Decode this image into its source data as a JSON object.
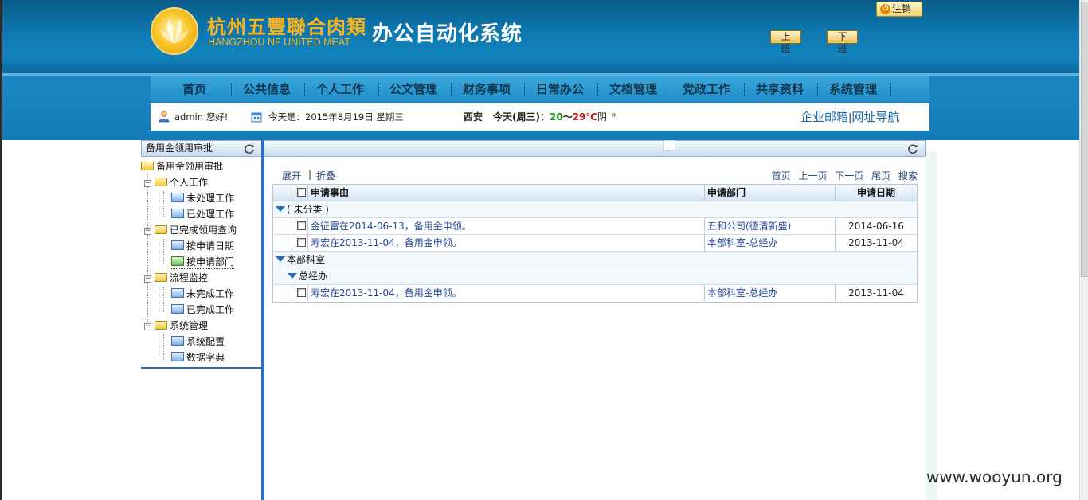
{
  "header": {
    "company_cn": "杭州五豐聯合肉類",
    "company_en": "HANGZHOU NF UNITED MEAT",
    "system_title": "办公自动化系统",
    "btn_on_duty": "上 班",
    "btn_off_duty": "下 班",
    "logout": "注销"
  },
  "nav": {
    "items": [
      "首页",
      "公共信息",
      "个人工作",
      "公文管理",
      "财务事项",
      "日常办公",
      "文档管理",
      "党政工作",
      "共享资料",
      "系统管理"
    ]
  },
  "info": {
    "user": "admin 您好!",
    "date": "今天是：2015年8月19日 星期三",
    "city": "西安",
    "weather_prefix": "今天(周三)：",
    "temp_low": "20",
    "temp_sep": "～",
    "temp_high": "29℃",
    "weather_cond": "阴",
    "weather_more": "»",
    "link_mail": "企业邮箱",
    "link_sep": "|",
    "link_nav": "网址导航"
  },
  "left_panel": {
    "title": "备用金领用审批",
    "tree": [
      {
        "label": "备用金领用审批",
        "type": "folder",
        "level": 0
      },
      {
        "label": "个人工作",
        "type": "folder",
        "level": 1
      },
      {
        "label": "未处理工作",
        "type": "doc",
        "level": 2
      },
      {
        "label": "已处理工作",
        "type": "doc",
        "level": 2
      },
      {
        "label": "已完成领用查询",
        "type": "folder",
        "level": 1
      },
      {
        "label": "按申请日期",
        "type": "doc",
        "level": 2
      },
      {
        "label": "按申请部门",
        "type": "doc-green",
        "level": 2
      },
      {
        "label": "流程监控",
        "type": "folder",
        "level": 1
      },
      {
        "label": "未完成工作",
        "type": "doc",
        "level": 2
      },
      {
        "label": "已完成工作",
        "type": "doc",
        "level": 2
      },
      {
        "label": "系统管理",
        "type": "folder",
        "level": 1
      },
      {
        "label": "系统配置",
        "type": "doc",
        "level": 2
      },
      {
        "label": "数据字典",
        "type": "doc",
        "level": 2
      }
    ]
  },
  "main": {
    "expand": "展开",
    "pipe": "|",
    "collapse": "折叠",
    "pager": [
      "首页",
      "上一页",
      "下一页",
      "尾页",
      "搜索"
    ],
    "columns": [
      "申请事由",
      "申请部门",
      "申请日期"
    ],
    "group1": "( 未分类 )",
    "rows1": [
      {
        "reason": "金征雷在2014-06-13，备用金申领。",
        "dept": "五和公司(德清新盛)",
        "date": "2014-06-16"
      },
      {
        "reason": "寿宏在2013-11-04，备用金申领。",
        "dept": "本部科室-总经办",
        "date": "2013-11-04"
      }
    ],
    "group2": "本部科室",
    "group2sub": "总经办",
    "rows2": [
      {
        "reason": "寿宏在2013-11-04，备用金申领。",
        "dept": "本部科室-总经办",
        "date": "2013-11-04"
      }
    ]
  },
  "watermark": "www.wooyun.org"
}
